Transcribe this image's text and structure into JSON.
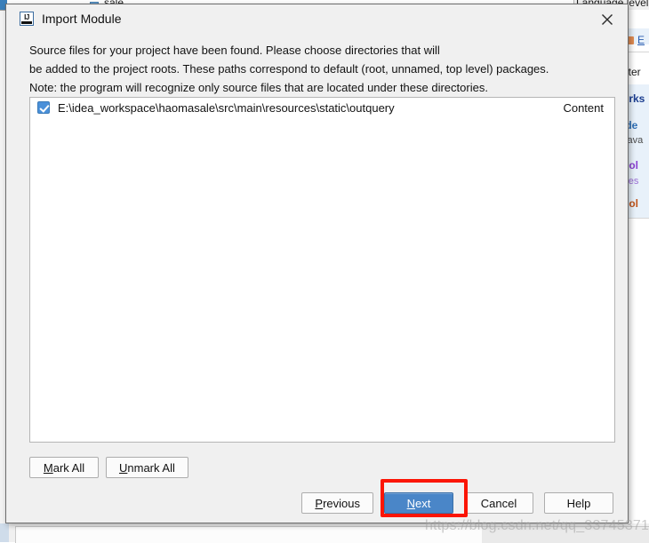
{
  "dialog": {
    "icon_name": "intellij-idea-icon",
    "icon_text": "IJ",
    "title": "Import Module",
    "close_label": "×",
    "description_lines": [
      "Source files for your project have been found. Please choose directories that will",
      "be added to the project roots. These paths correspond to default (root, unnamed, top level) packages.",
      "Note: the program will recognize only source files that are located under these directories."
    ],
    "list": {
      "rows": [
        {
          "checked": true,
          "path": "E:\\idea_workspace\\haomasale\\src\\main\\resources\\static\\outquery",
          "content_label": "Content"
        }
      ]
    },
    "mark_buttons": [
      {
        "name": "mark-all-button",
        "mnemonic": "M",
        "rest": "ark All"
      },
      {
        "name": "unmark-all-button",
        "mnemonic": "U",
        "rest": "nmark All"
      }
    ],
    "action_buttons": [
      {
        "name": "previous-button",
        "mnemonic": "P",
        "rest": "revious",
        "primary": false
      },
      {
        "name": "next-button",
        "mnemonic": "N",
        "rest": "ext",
        "primary": true
      },
      {
        "name": "cancel-button",
        "mnemonic": "",
        "rest": "Cancel",
        "primary": false
      },
      {
        "name": "help-button",
        "mnemonic": "",
        "rest": "Help",
        "primary": false
      }
    ],
    "colors": {
      "primary_button": "#4a86c8",
      "checkbox": "#4a90d9",
      "highlight_box": "#fb1505",
      "dialog_background": "#f0f0f0"
    }
  },
  "background": {
    "top_strip": {
      "tree_item": "sale",
      "right_label": "Language level"
    },
    "right_panel": {
      "rows": [
        {
          "text": "E",
          "style": "link"
        },
        {
          "text": "nter",
          "style": "plain"
        },
        {
          "text": "orks",
          "style": "blue-bold"
        },
        {
          "text": "lde",
          "style": "blue"
        },
        {
          "text": "\\java",
          "style": "grey"
        },
        {
          "text": "Fol",
          "style": "purple"
        },
        {
          "text": "\\res",
          "style": "purple-lite"
        },
        {
          "text": "Fol",
          "style": "orange"
        }
      ]
    }
  },
  "watermark": {
    "text": "https://blog.csdn.net/qq_33745371"
  }
}
